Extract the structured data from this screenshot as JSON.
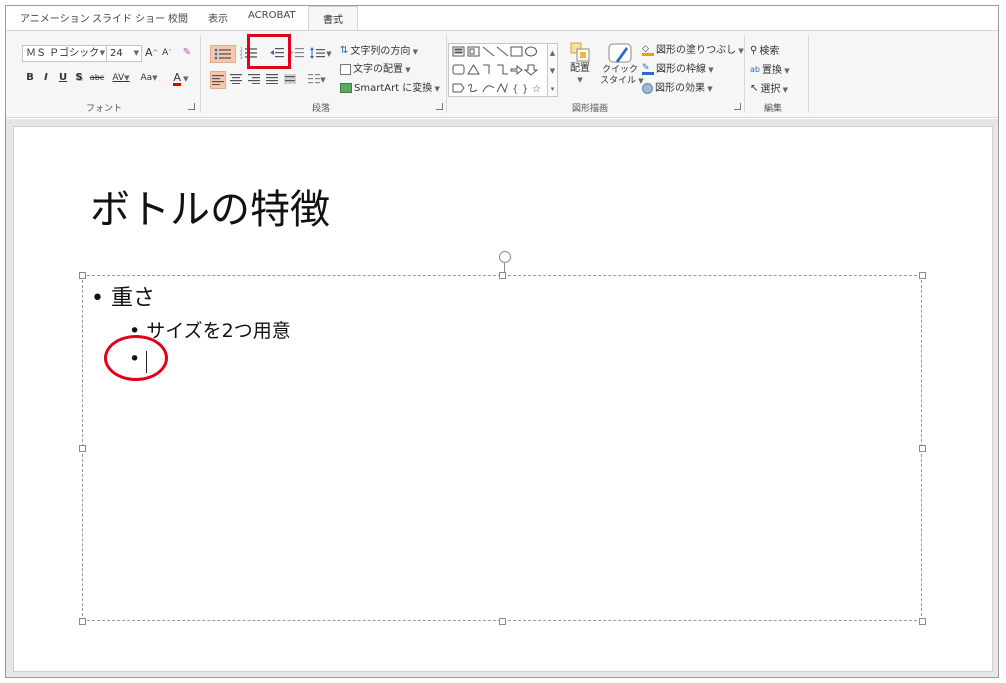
{
  "tabs": [
    {
      "label": "アニメーション",
      "active": false
    },
    {
      "label": "スライド ショー",
      "active": false
    },
    {
      "label": "校閲",
      "active": false
    },
    {
      "label": "表示",
      "active": false
    },
    {
      "label": "ACROBAT",
      "active": false
    },
    {
      "label": "書式",
      "active": true
    }
  ],
  "font_group": {
    "font_name": "ＭＳ Ｐゴシック",
    "font_size": "24",
    "grow_label": "A",
    "shrink_label": "A",
    "bold": "B",
    "italic": "I",
    "underline": "U",
    "shadow": "S",
    "strike": "abc",
    "spacing": "AV",
    "case": "Aa",
    "color_a": "A",
    "label": "フォント"
  },
  "paragraph_group": {
    "text_direction": "文字列の方向",
    "align_text": "文字の配置",
    "smartart": "SmartArt に変換",
    "label": "段落"
  },
  "drawing_group": {
    "arrange": "配置",
    "quick_styles_1": "クイック",
    "quick_styles_2": "スタイル",
    "shape_fill": "図形の塗りつぶし",
    "shape_outline": "図形の枠線",
    "shape_effects": "図形の効果",
    "label": "図形描画"
  },
  "editing_group": {
    "find": "検索",
    "replace": "置換",
    "select": "選択",
    "label": "編集"
  },
  "slide": {
    "title": "ボトルの特徴",
    "bullets": [
      {
        "level": 1,
        "text": "重さ"
      },
      {
        "level": 2,
        "text": "サイズを2つ用意"
      },
      {
        "level": 2,
        "text": ""
      }
    ]
  },
  "colors": {
    "annotation": "#e3001b",
    "selected_button": "#f5c7b0",
    "font_color_bar": "#e00000"
  }
}
